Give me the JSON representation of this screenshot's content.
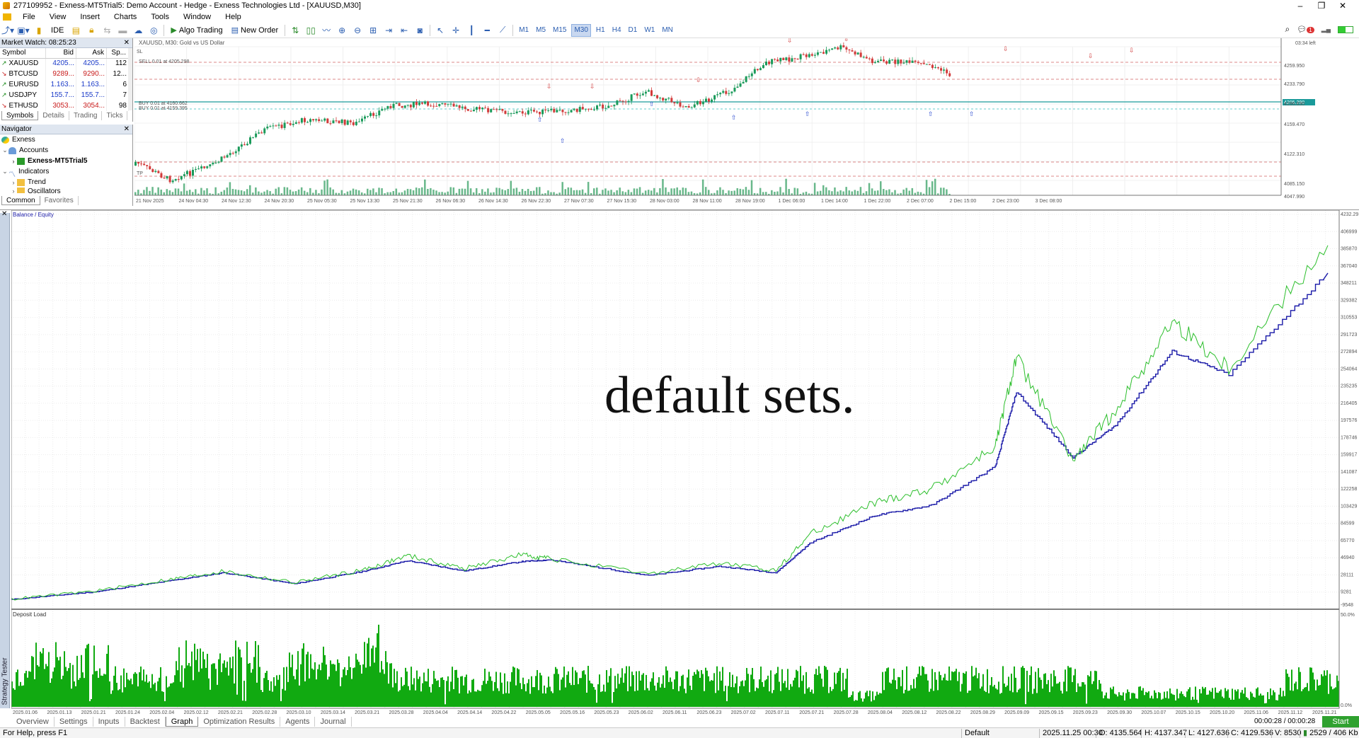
{
  "window": {
    "title": "277109952 - Exness-MT5Trial5: Demo Account - Hedge - Exness Technologies Ltd - [XAUUSD,M30]",
    "controls": [
      "–",
      "❐",
      "✕"
    ]
  },
  "menu": [
    "File",
    "View",
    "Insert",
    "Charts",
    "Tools",
    "Window",
    "Help"
  ],
  "toolbar": {
    "ide_label": "IDE",
    "algo_trading": "Algo Trading",
    "new_order": "New Order",
    "timeframes": [
      "M1",
      "M5",
      "M15",
      "M30",
      "H1",
      "H4",
      "D1",
      "W1",
      "MN"
    ],
    "active_timeframe": "M30",
    "notification_count": "1"
  },
  "market_watch": {
    "title": "Market Watch: 08:25:23",
    "columns": [
      "Symbol",
      "Bid",
      "Ask",
      "Sp..."
    ],
    "rows": [
      {
        "symbol": "XAUUSD",
        "dir": "up",
        "bid": "4205...",
        "ask": "4205...",
        "spread": "112"
      },
      {
        "symbol": "BTCUSD",
        "dir": "down",
        "bid": "9289...",
        "ask": "9290...",
        "spread": "12..."
      },
      {
        "symbol": "EURUSD",
        "dir": "up",
        "bid": "1.163...",
        "ask": "1.163...",
        "spread": "6"
      },
      {
        "symbol": "USDJPY",
        "dir": "up",
        "bid": "155.7...",
        "ask": "155.7...",
        "spread": "7"
      },
      {
        "symbol": "ETHUSD",
        "dir": "down",
        "bid": "3053...",
        "ask": "3054...",
        "spread": "98"
      }
    ],
    "tabs": [
      "Symbols",
      "Details",
      "Trading",
      "Ticks"
    ]
  },
  "navigator": {
    "title": "Navigator",
    "items": [
      "Exness",
      "Accounts",
      "Exness-MT5Trial5",
      "Indicators",
      "Trend",
      "Oscillators"
    ],
    "tabs": [
      "Common",
      "Favorites"
    ]
  },
  "chart": {
    "header": "XAUUSD, M30:  Gold vs US Dollar",
    "sell_label": "SELL 0.01 at 4205.298",
    "buy_labels": [
      "BUY 0.01 at 4160.662",
      "BUY 0.01 at 4159.395"
    ],
    "sl_label": "SL",
    "tp_label": "TP",
    "price_labels": [
      "4259.950",
      "4233.790",
      "4205.298",
      "4196.630",
      "4159.470",
      "4122.310",
      "4085.150",
      "4047.990"
    ],
    "time_labels": [
      "21 Nov 2025",
      "24 Nov 04:30",
      "24 Nov 12:30",
      "24 Nov 20:30",
      "25 Nov 05:30",
      "25 Nov 13:30",
      "25 Nov 21:30",
      "26 Nov 06:30",
      "26 Nov 14:30",
      "26 Nov 22:30",
      "27 Nov 07:30",
      "27 Nov 15:30",
      "28 Nov 03:00",
      "28 Nov 11:00",
      "28 Nov 19:00",
      "1 Dec 06:00",
      "1 Dec 14:00",
      "1 Dec 22:00",
      "2 Dec 07:00",
      "2 Dec 15:00",
      "2 Dec 23:00",
      "3 Dec 08:00"
    ],
    "corner_label": "03:34 left"
  },
  "tester": {
    "side_label": "Strategy Tester",
    "legend": "Balance / Equity",
    "load_label": "Deposit Load",
    "load_axis": [
      "50.0%",
      "0.0%"
    ],
    "y_labels": [
      "4232.29",
      "406999",
      "385870",
      "367040",
      "348211",
      "329382",
      "310553",
      "291723",
      "272894",
      "254064",
      "235235",
      "216405",
      "197576",
      "178746",
      "159917",
      "141087",
      "122258",
      "103429",
      "84599",
      "65770",
      "46940",
      "28111",
      "9281",
      "-9548"
    ],
    "x_labels": [
      "2025.01.06",
      "2025.01.13",
      "2025.01.21",
      "2025.01.24",
      "2025.02.04",
      "2025.02.12",
      "2025.02.21",
      "2025.02.28",
      "2025.03.10",
      "2025.03.14",
      "2025.03.21",
      "2025.03.28",
      "2025.04.04",
      "2025.04.14",
      "2025.04.22",
      "2025.05.05",
      "2025.05.16",
      "2025.05.23",
      "2025.06.02",
      "2025.06.11",
      "2025.06.23",
      "2025.07.02",
      "2025.07.11",
      "2025.07.21",
      "2025.07.28",
      "2025.08.04",
      "2025.08.12",
      "2025.08.22",
      "2025.08.29",
      "2025.09.09",
      "2025.09.15",
      "2025.09.23",
      "2025.09.30",
      "2025.10.07",
      "2025.10.15",
      "2025.10.20",
      "2025.11.06",
      "2025.11.12",
      "2025.11.21"
    ],
    "caption": "default sets.",
    "bottom_tabs": [
      "Overview",
      "Settings",
      "Inputs",
      "Backtest",
      "Graph",
      "Optimization Results",
      "Agents",
      "Journal"
    ],
    "active_tab": "Graph",
    "timer": "00:00:28 / 00:00:28",
    "start": "Start"
  },
  "status": {
    "help": "For Help, press F1",
    "profile": "Default",
    "time": "2025.11.25 00:30",
    "open": "O: 4135.564",
    "high": "H: 4137.347",
    "low": "L: 4127.636",
    "close": "C: 4129.536",
    "volume": "V: 8530",
    "traffic": "2529 / 406 Kb"
  },
  "chart_data": {
    "type": "line",
    "title": "",
    "xlabel": "",
    "ylabel": "",
    "series": [
      {
        "name": "Balance",
        "color": "#1a1aa8",
        "values": [
          1000,
          9500,
          22000,
          30000,
          18000,
          32000,
          43000,
          32000,
          42000,
          44000,
          27000,
          37000,
          30000,
          63000,
          92000,
          103000,
          145000,
          226000,
          155000,
          190000,
          270000,
          245000,
          355000
        ]
      },
      {
        "name": "Equity",
        "color": "#2cbf2c",
        "values": [
          1000,
          10000,
          23000,
          31000,
          19000,
          33000,
          48000,
          34000,
          49000,
          45000,
          28000,
          40000,
          32000,
          72000,
          105000,
          120000,
          165000,
          262000,
          150000,
          205000,
          300000,
          250000,
          385000
        ]
      }
    ],
    "ylim": [
      -9548,
      423229
    ],
    "legend": "top-left",
    "grid": true
  }
}
